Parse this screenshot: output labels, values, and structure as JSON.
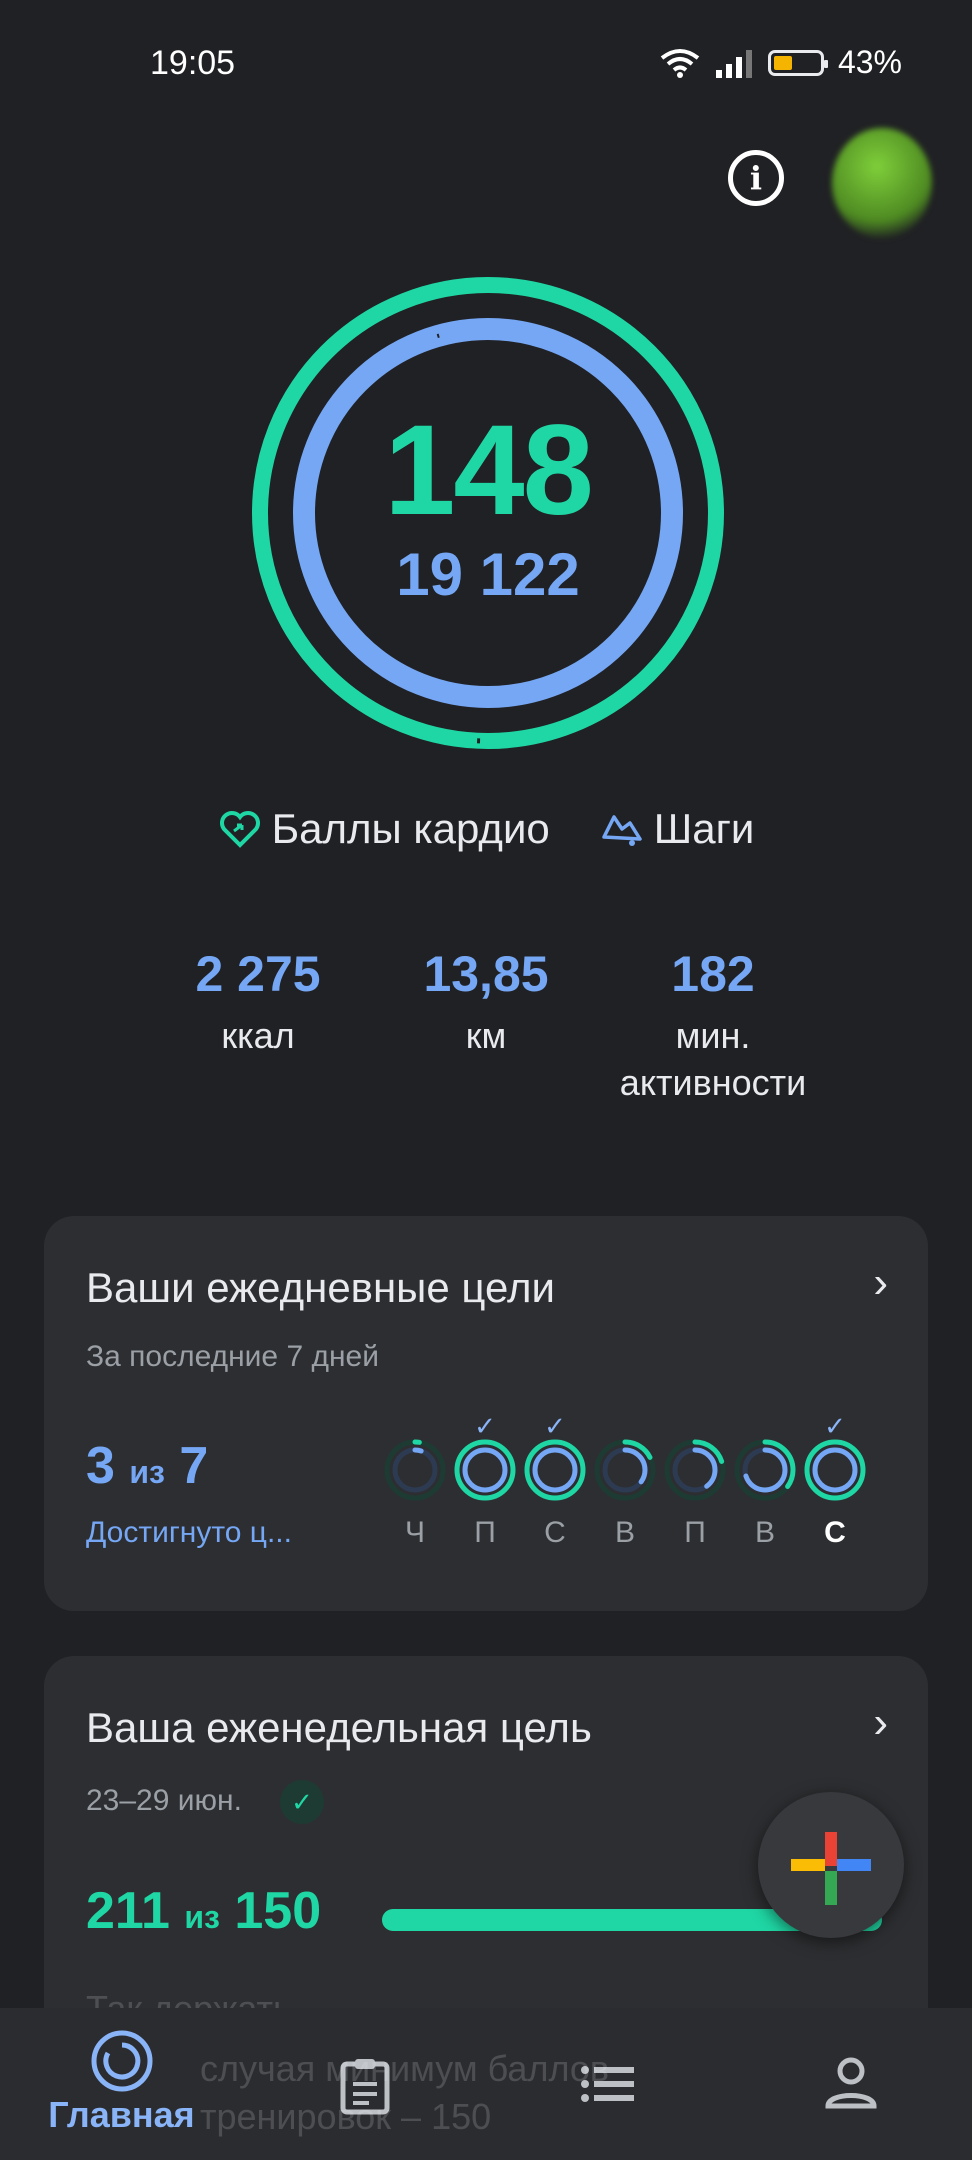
{
  "status_bar": {
    "time": "19:05",
    "battery": "43%"
  },
  "summary": {
    "heart_points": "148",
    "steps": "19 122"
  },
  "legend": {
    "heart": "Баллы кардио",
    "steps": "Шаги"
  },
  "stats": [
    {
      "value": "2 275",
      "label": "ккал"
    },
    {
      "value": "13,85",
      "label": "км"
    },
    {
      "value": "182",
      "label": "мин.\nактивности"
    }
  ],
  "daily_goals": {
    "title": "Ваши ежедневные цели",
    "subtitle": "За последние 7 дней",
    "count": "3",
    "of": "из",
    "total": "7",
    "label": "Достигнуто ц...",
    "days": [
      {
        "label": "Ч",
        "achieved": false,
        "progress": 0.05
      },
      {
        "label": "П",
        "achieved": true,
        "progress": 1.0
      },
      {
        "label": "С",
        "achieved": true,
        "progress": 1.0
      },
      {
        "label": "В",
        "achieved": false,
        "progress": 0.35
      },
      {
        "label": "П",
        "achieved": false,
        "progress": 0.4
      },
      {
        "label": "В",
        "achieved": false,
        "progress": 0.7
      },
      {
        "label": "С",
        "achieved": true,
        "progress": 1.0,
        "today": true
      }
    ]
  },
  "weekly_goal": {
    "title": "Ваша еженедельная цель",
    "dates": "23–29 июн.",
    "count": "211",
    "of": "из",
    "total": "150",
    "progress": 1.0,
    "faded_line1": "Так держать",
    "faded_line2": "случая минимум баллов",
    "faded_line3": "тренировок – 150"
  },
  "nav": [
    {
      "label": "Главная",
      "icon": "home-ring-icon",
      "active": true
    },
    {
      "label": "",
      "icon": "journal-icon",
      "active": false
    },
    {
      "label": "",
      "icon": "list-icon",
      "active": false
    },
    {
      "label": "",
      "icon": "profile-icon",
      "active": false
    }
  ],
  "colors": {
    "accent_green": "#1fd7a4",
    "accent_blue": "#75a7f5",
    "background": "#202124",
    "card": "#2d2e31"
  }
}
